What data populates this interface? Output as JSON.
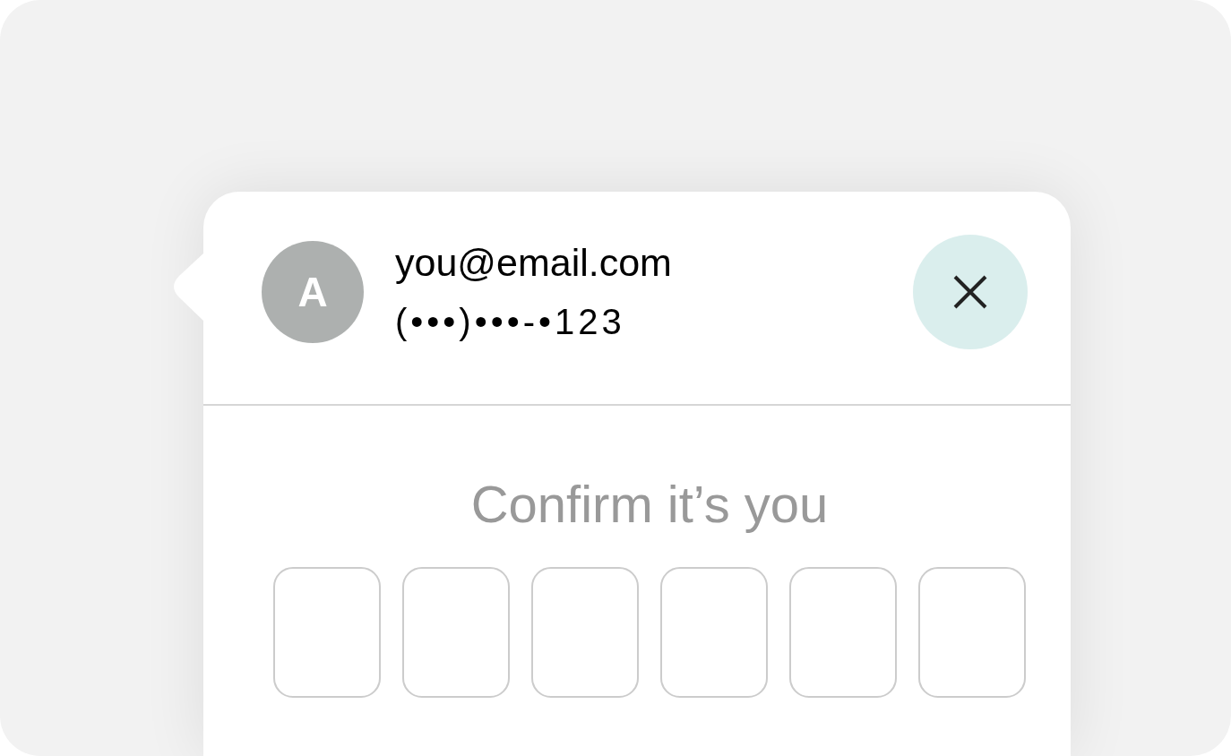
{
  "account": {
    "avatar_initial": "A",
    "email": "you@email.com",
    "phone": "(•••)•••-•123"
  },
  "verification": {
    "title": "Confirm it’s you",
    "code_fields": [
      {
        "focused": false
      },
      {
        "focused": false
      },
      {
        "focused": false
      },
      {
        "focused": false
      },
      {
        "focused": false
      },
      {
        "focused": false
      }
    ]
  }
}
